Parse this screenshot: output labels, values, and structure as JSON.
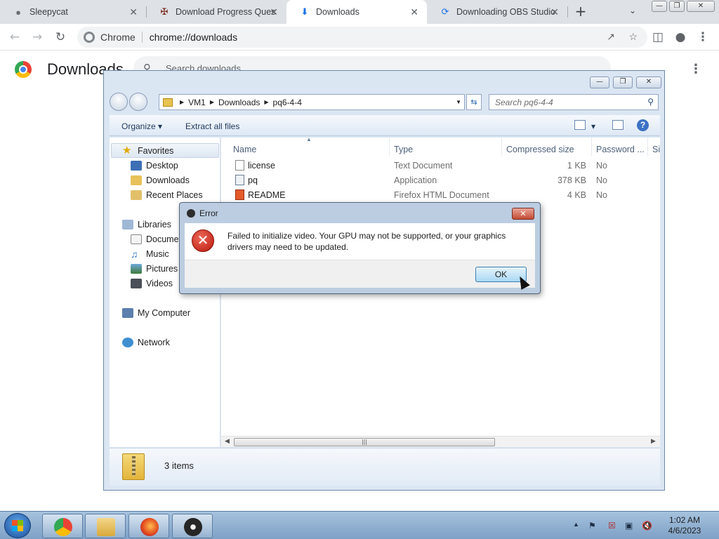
{
  "chrome": {
    "tabs": [
      {
        "title": "Sleepycat",
        "icon": "sleepycat-icon"
      },
      {
        "title": "Download Progress Ques",
        "icon": "game-icon"
      },
      {
        "title": "Downloads",
        "icon": "download-icon"
      },
      {
        "title": "Downloading OBS Studio",
        "icon": "loading-icon"
      }
    ],
    "active_tab": 2,
    "omnibox": {
      "chip": "Chrome",
      "url": "chrome://downloads"
    },
    "accent": "#1a73e8"
  },
  "downloads_page": {
    "title": "Downloads",
    "search_placeholder": "Search downloads"
  },
  "explorer": {
    "breadcrumb": [
      "VM1",
      "Downloads",
      "pq6-4-4"
    ],
    "search_placeholder": "Search pq6-4-4",
    "commands": {
      "organize": "Organize",
      "extract": "Extract all files"
    },
    "nav": {
      "favorites": "Favorites",
      "favorites_items": [
        "Desktop",
        "Downloads",
        "Recent Places"
      ],
      "libraries": "Libraries",
      "libraries_items": [
        "Documents",
        "Music",
        "Pictures",
        "Videos"
      ],
      "computer": "My Computer",
      "network": "Network"
    },
    "columns": [
      "Name",
      "Type",
      "Compressed size",
      "Password ...",
      "Si"
    ],
    "files": [
      {
        "name": "license",
        "type": "Text Document",
        "size": "1 KB",
        "password": "No",
        "icon": "text-file-icon"
      },
      {
        "name": "pq",
        "type": "Application",
        "size": "378 KB",
        "password": "No",
        "icon": "application-icon"
      },
      {
        "name": "README",
        "type": "Firefox HTML Document",
        "size": "4 KB",
        "password": "No",
        "icon": "firefox-html-icon"
      }
    ],
    "status": "3 items"
  },
  "error_dialog": {
    "title": "Error",
    "message": "Failed to initialize video.  Your GPU may not be supported, or your graphics drivers may need to be updated.",
    "ok_label": "OK"
  },
  "taskbar": {
    "apps": [
      "chrome-icon",
      "explorer-icon",
      "firefox-icon",
      "obs-icon"
    ],
    "time": "1:02 AM",
    "date": "4/6/2023"
  }
}
